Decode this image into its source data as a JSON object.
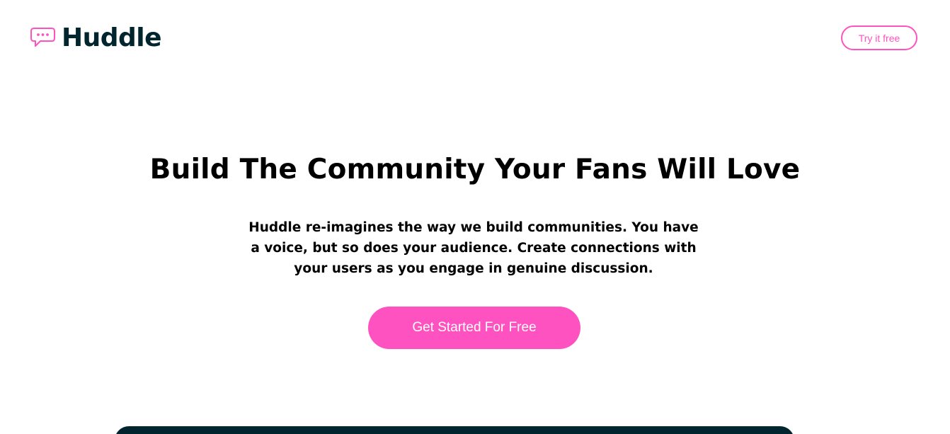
{
  "header": {
    "logo_text": "Huddle",
    "logo_icon": "chat-bubble-icon",
    "try_button_label": "Try it free"
  },
  "hero": {
    "title": "Build The Community Your Fans Will Love",
    "description": "Huddle re-imagines the way we build communities. You have a voice, but so does your audience. Create connections with your users as you engage in genuine discussion.",
    "cta_label": "Get Started For Free"
  },
  "colors": {
    "accent": "#ff52c1",
    "dark": "#00252e",
    "background": "#ffffff"
  }
}
